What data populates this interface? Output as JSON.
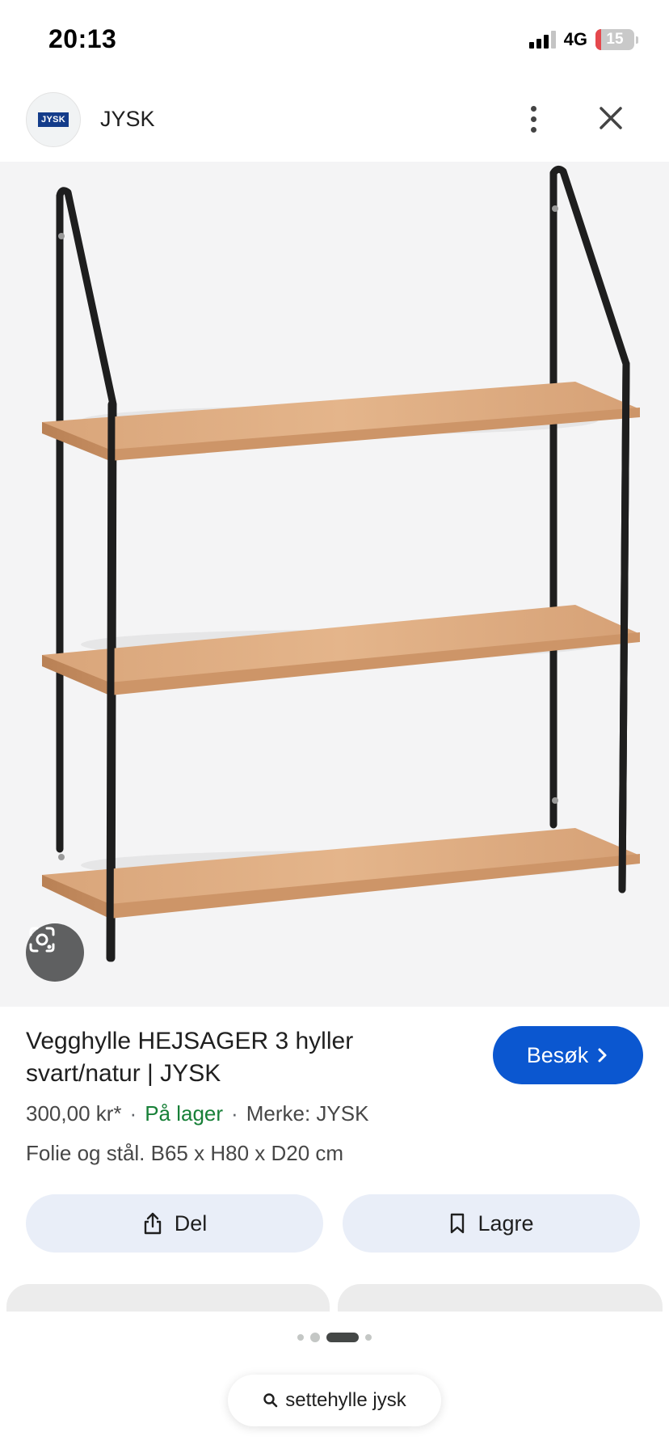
{
  "status": {
    "time": "20:13",
    "network": "4G",
    "battery": "15",
    "battery_level": 0.15,
    "battery_color": "#e5484d"
  },
  "site": {
    "logo_text": "JYSK",
    "name": "JYSK"
  },
  "hero": {
    "background": "#f4f4f5",
    "lens_icon": "google-lens-icon"
  },
  "product": {
    "title": "Vegghylle HEJSAGER 3 hyller svart/natur | JYSK",
    "price": "300,00 kr*",
    "stock": "På lager",
    "brand": "Merke: JYSK",
    "description": "Folie og stål. B65 x H80 x D20 cm",
    "stock_color": "#188038"
  },
  "visit_button": {
    "label": "Besøk",
    "color": "#0b57d0"
  },
  "actions": {
    "share_label": "Del",
    "save_label": "Lagre",
    "share_icon": "share-icon",
    "save_icon": "bookmark-icon"
  },
  "pager": {
    "current_page": 3,
    "total_pages": 4
  },
  "search": {
    "query": "settehylle jysk",
    "icon": "search-icon"
  }
}
